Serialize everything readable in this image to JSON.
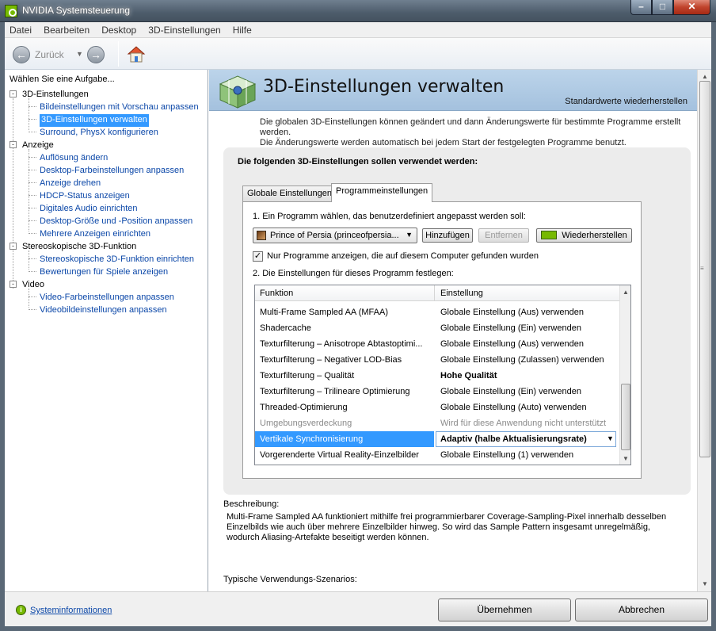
{
  "window": {
    "title": "NVIDIA Systemsteuerung"
  },
  "menu": [
    "Datei",
    "Bearbeiten",
    "Desktop",
    "3D-Einstellungen",
    "Hilfe"
  ],
  "toolbar": {
    "back_label": "Zurück"
  },
  "sidebar": {
    "header": "Wählen Sie eine Aufgabe...",
    "categories": [
      {
        "label": "3D-Einstellungen",
        "items": [
          "Bildeinstellungen mit Vorschau anpassen",
          "3D-Einstellungen verwalten",
          "Surround, PhysX konfigurieren"
        ]
      },
      {
        "label": "Anzeige",
        "items": [
          "Auflösung ändern",
          "Desktop-Farbeinstellungen anpassen",
          "Anzeige drehen",
          "HDCP-Status anzeigen",
          "Digitales Audio einrichten",
          "Desktop-Größe und -Position anpassen",
          "Mehrere Anzeigen einrichten"
        ]
      },
      {
        "label": "Stereoskopische 3D-Funktion",
        "items": [
          "Stereoskopische 3D-Funktion einrichten",
          "Bewertungen für Spiele anzeigen"
        ]
      },
      {
        "label": "Video",
        "items": [
          "Video-Farbeinstellungen anpassen",
          "Videobildeinstellungen anpassen"
        ]
      }
    ],
    "selected": "3D-Einstellungen verwalten"
  },
  "page": {
    "title": "3D-Einstellungen verwalten",
    "restore_defaults": "Standardwerte wiederherstellen",
    "intro_line1": "Die globalen 3D-Einstellungen können geändert und dann Änderungswerte für bestimmte Programme erstellt werden.",
    "intro_line2": "Die Änderungswerte werden automatisch bei jedem Start der festgelegten Programme benutzt.",
    "settings_heading": "Die folgenden 3D-Einstellungen sollen verwendet werden:",
    "tabs": [
      "Globale Einstellungen",
      "Programmeinstellungen"
    ],
    "active_tab": "Programmeinstellungen",
    "step1": "1. Ein Programm wählen, das benutzerdefiniert angepasst werden soll:",
    "program_select": "Prince of Persia (princeofpersia...",
    "buttons": {
      "add": "Hinzufügen",
      "remove": "Entfernen",
      "restore": "Wiederherstellen"
    },
    "only_installed_label": "Nur Programme anzeigen, die auf diesem Computer gefunden wurden",
    "only_installed_checked": "✓",
    "step2": "2. Die Einstellungen für dieses Programm festlegen:",
    "grid": {
      "columns": [
        "Funktion",
        "Einstellung"
      ],
      "rows": [
        {
          "feature": "Multi-Frame Sampled AA (MFAA)",
          "setting": "Globale Einstellung (Aus) verwenden"
        },
        {
          "feature": "Shadercache",
          "setting": "Globale Einstellung (Ein) verwenden"
        },
        {
          "feature": "Texturfilterung – Anisotrope Abtastoptimi...",
          "setting": "Globale Einstellung (Aus) verwenden"
        },
        {
          "feature": "Texturfilterung – Negativer LOD-Bias",
          "setting": "Globale Einstellung (Zulassen) verwenden"
        },
        {
          "feature": "Texturfilterung – Qualität",
          "setting": "Hohe Qualität"
        },
        {
          "feature": "Texturfilterung – Trilineare Optimierung",
          "setting": "Globale Einstellung (Ein) verwenden"
        },
        {
          "feature": "Threaded-Optimierung",
          "setting": "Globale Einstellung (Auto) verwenden"
        },
        {
          "feature": "Umgebungsverdeckung",
          "setting": "Wird für diese Anwendung nicht unterstützt"
        },
        {
          "feature": "Vertikale Synchronisierung",
          "setting": "Adaptiv (halbe Aktualisierungsrate)"
        },
        {
          "feature": "Vorgerenderte Virtual Reality-Einzelbilder",
          "setting": "Globale Einstellung (1) verwenden"
        }
      ]
    },
    "description_label": "Beschreibung:",
    "description_text": "Multi-Frame Sampled AA funktioniert mithilfe frei programmierbarer Coverage-Sampling-Pixel innerhalb desselben Einzelbilds wie auch über mehrere Einzelbilder hinweg. So wird das Sample Pattern insgesamt unregelmäßig, wodurch Aliasing-Artefakte beseitigt werden können.",
    "usage_label": "Typische Verwendungs-Szenarios:"
  },
  "footer": {
    "sysinfo": "Systeminformationen",
    "apply": "Übernehmen",
    "cancel": "Abbrechen"
  },
  "colors": {
    "nvidia_green": "#76b900",
    "selection_blue": "#3399ff",
    "link_blue": "#0b47a8",
    "banner_blue": "#a4c1de"
  }
}
